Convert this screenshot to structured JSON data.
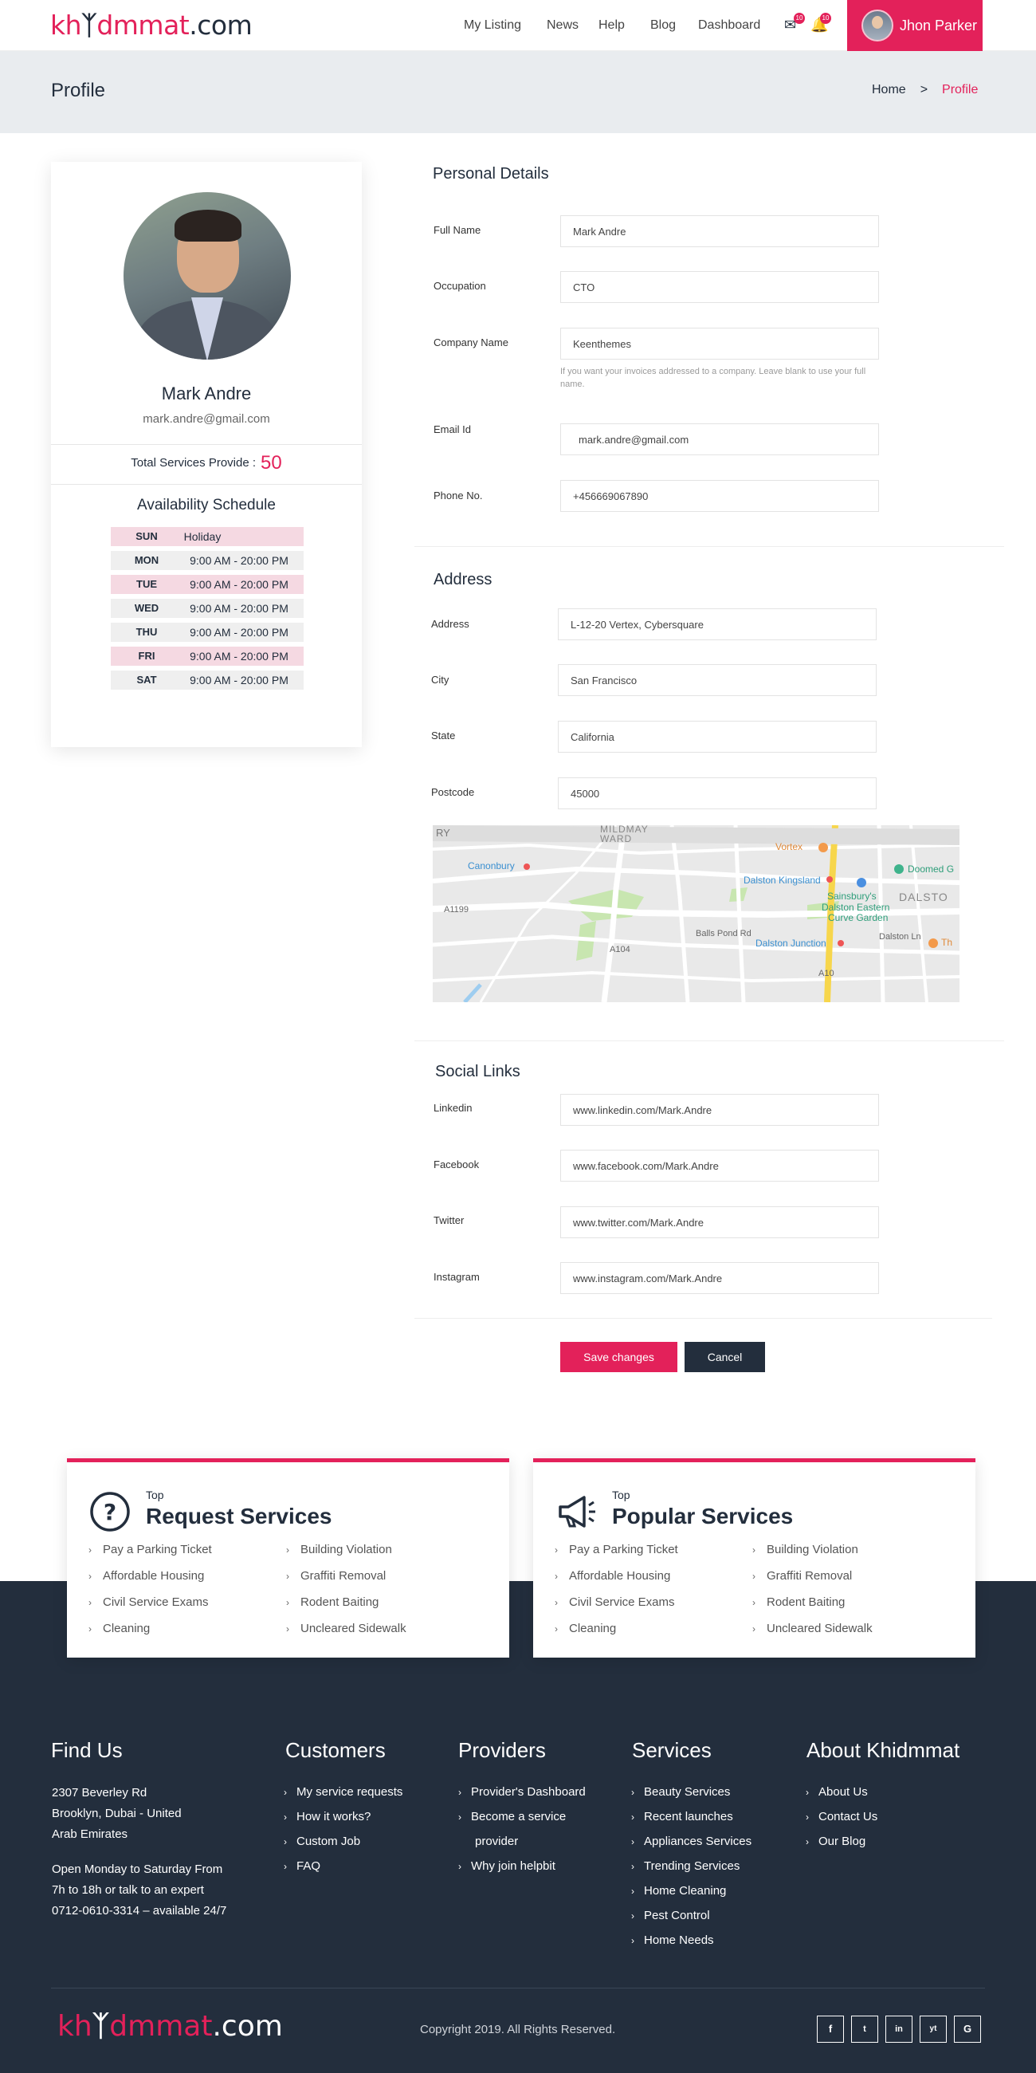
{
  "brand": {
    "part1": "kh",
    "part2": "dmmat",
    "part3": ".com"
  },
  "nav": {
    "items": [
      "My Listing",
      "News",
      "Help",
      "Blog",
      "Dashboard"
    ],
    "mail_count": "10",
    "bell_count": "10",
    "user_name": "Jhon Parker"
  },
  "page": {
    "title": "Profile",
    "breadcrumb_home": "Home",
    "breadcrumb_sep": ">",
    "breadcrumb_current": "Profile"
  },
  "profile": {
    "name": "Mark Andre",
    "email": "mark.andre@gmail.com",
    "services_label": "Total Services Provide :",
    "services_count": "50",
    "schedule_title": "Availability Schedule",
    "schedule": [
      {
        "day": "SUN",
        "hours": "Holiday"
      },
      {
        "day": "MON",
        "hours": "9:00 AM - 20:00 PM"
      },
      {
        "day": "TUE",
        "hours": "9:00 AM - 20:00 PM"
      },
      {
        "day": "WED",
        "hours": "9:00 AM - 20:00 PM"
      },
      {
        "day": "THU",
        "hours": "9:00 AM - 20:00 PM"
      },
      {
        "day": "FRI",
        "hours": "9:00 AM - 20:00 PM"
      },
      {
        "day": "SAT",
        "hours": "9:00 AM - 20:00 PM"
      }
    ]
  },
  "personal": {
    "title": "Personal Details",
    "full_name_label": "Full Name",
    "full_name": "Mark Andre",
    "occupation_label": "Occupation",
    "occupation": "CTO",
    "company_label": "Company Name",
    "company": "Keenthemes",
    "company_help": "If you want your invoices addressed to a company. Leave blank to use your full name.",
    "email_label": "Email Id",
    "email": "mark.andre@gmail.com",
    "phone_label": "Phone No.",
    "phone": "+456669067890"
  },
  "address": {
    "title": "Address",
    "address_label": "Address",
    "address": "L-12-20 Vertex, Cybersquare",
    "city_label": "City",
    "city": "San Francisco",
    "state_label": "State",
    "state": "California",
    "postcode_label": "Postcode",
    "postcode": "45000",
    "map_labels": [
      "RY",
      "MILDMAY",
      "WARD",
      "Canonbury",
      "Dalston Kingsland",
      "Vortex",
      "Doomed G",
      "DALSTO",
      "Sainsbury's",
      "Dalston Eastern",
      "Curve Garden",
      "Dalston Junction",
      "Balls Pond Rd",
      "Dalston Ln",
      "A1199",
      "A104",
      "A10",
      "Th"
    ]
  },
  "social": {
    "title": "Social Links",
    "linkedin_label": "Linkedin",
    "linkedin": "www.linkedin.com/Mark.Andre",
    "facebook_label": "Facebook",
    "facebook": "www.facebook.com/Mark.Andre",
    "twitter_label": "Twitter",
    "twitter": "www.twitter.com/Mark.Andre",
    "instagram_label": "Instagram",
    "instagram": "www.instagram.com/Mark.Andre"
  },
  "actions": {
    "save": "Save changes",
    "cancel": "Cancel"
  },
  "request_services": {
    "top": "Top",
    "title": "Request Services",
    "items": [
      "Pay a Parking Ticket",
      "Building Violation",
      "Affordable Housing",
      "Graffiti Removal",
      "Civil Service Exams",
      "Rodent Baiting",
      "Cleaning",
      "Uncleared Sidewalk"
    ]
  },
  "popular_services": {
    "top": "Top",
    "title": "Popular Services",
    "items": [
      "Pay a Parking Ticket",
      "Building Violation",
      "Affordable Housing",
      "Graffiti Removal",
      "Civil Service Exams",
      "Rodent Baiting",
      "Cleaning",
      "Uncleared Sidewalk"
    ]
  },
  "footer": {
    "find_us": {
      "title": "Find Us",
      "addr1": "2307 Beverley Rd",
      "addr2": "Brooklyn, Dubai - United",
      "addr3": "Arab Emirates",
      "hours1": "Open Monday to Saturday From",
      "hours2": "7h to 18h or talk to an expert",
      "hours3": "0712-0610-3314 – available 24/7"
    },
    "customers": {
      "title": "Customers",
      "links": [
        "My service requests",
        "How it works?",
        "Custom Job",
        "FAQ"
      ]
    },
    "providers": {
      "title": "Providers",
      "links": [
        "Provider's Dashboard",
        "Become a service",
        "provider",
        "Why join helpbit"
      ]
    },
    "services": {
      "title": "Services",
      "links": [
        "Beauty Services",
        "Recent launches",
        "Appliances Services",
        "Trending Services",
        "Home Cleaning",
        "Pest Control",
        "Home Needs"
      ]
    },
    "about": {
      "title": "About Khidmmat",
      "links": [
        "About Us",
        "Contact Us",
        "Our Blog"
      ]
    },
    "copyright": "Copyright 2019. All Rights Reserved.",
    "social": [
      "f",
      "t",
      "in",
      "yt",
      "G"
    ]
  },
  "colors": {
    "accent": "#e3215a",
    "dark": "#232e3d",
    "title_bar": "#e9ecef"
  }
}
